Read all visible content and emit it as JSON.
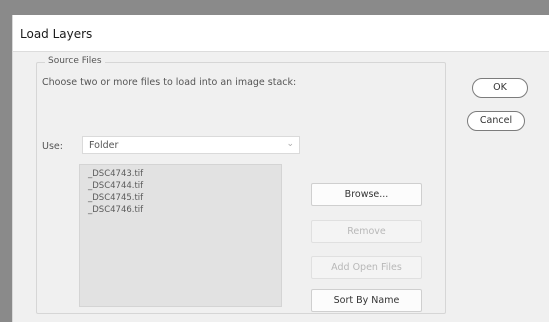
{
  "window": {
    "title": "Load Layers"
  },
  "source_files": {
    "legend": "Source Files",
    "instructions": "Choose two or more files to load into an image stack:",
    "use_label": "Use:",
    "use_value": "Folder",
    "files": [
      "_DSC4743.tif",
      "_DSC4744.tif",
      "_DSC4745.tif",
      "_DSC4746.tif"
    ]
  },
  "buttons": {
    "ok": "OK",
    "cancel": "Cancel",
    "browse": "Browse...",
    "remove": "Remove",
    "add_open_files": "Add Open Files",
    "sort_by_name": "Sort By Name"
  }
}
